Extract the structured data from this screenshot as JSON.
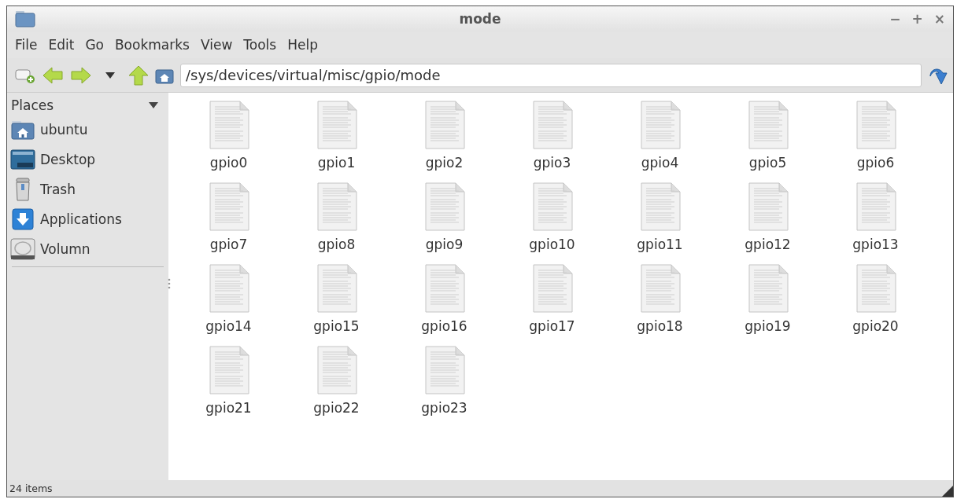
{
  "window": {
    "title": "mode",
    "controls": [
      "−",
      "+",
      "×"
    ]
  },
  "menu": [
    "File",
    "Edit",
    "Go",
    "Bookmarks",
    "View",
    "Tools",
    "Help"
  ],
  "toolbar": {
    "path": "/sys/devices/virtual/misc/gpio/mode"
  },
  "sidebar": {
    "title": "Places",
    "items": [
      {
        "label": "ubuntu",
        "kind": "home"
      },
      {
        "label": "Desktop",
        "kind": "desktop"
      },
      {
        "label": "Trash",
        "kind": "trash"
      },
      {
        "label": "Applications",
        "kind": "applications"
      },
      {
        "label": "Volumn",
        "kind": "volume"
      }
    ]
  },
  "files": [
    "gpio0",
    "gpio1",
    "gpio2",
    "gpio3",
    "gpio4",
    "gpio5",
    "gpio6",
    "gpio7",
    "gpio8",
    "gpio9",
    "gpio10",
    "gpio11",
    "gpio12",
    "gpio13",
    "gpio14",
    "gpio15",
    "gpio16",
    "gpio17",
    "gpio18",
    "gpio19",
    "gpio20",
    "gpio21",
    "gpio22",
    "gpio23"
  ],
  "status_bar": "24 items"
}
